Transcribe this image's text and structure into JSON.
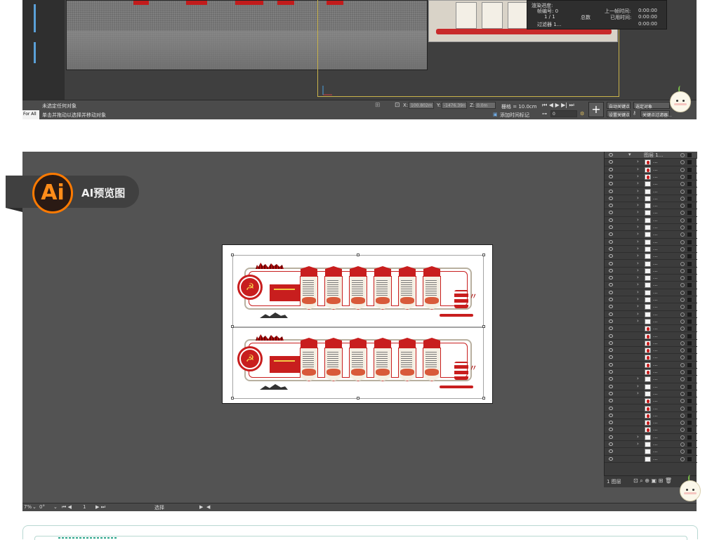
{
  "max_viewport": {
    "render_dialog": {
      "progress_label": "渲染进度:",
      "frame_label": "帧编号: 0",
      "frame_count": "1 / 1",
      "total_label": "总数",
      "prev_frame_label": "上一帧时间:",
      "prev_frame_time": "0:00:00",
      "elapsed_label": "已用时间:",
      "elapsed_time": "0:00:00",
      "last_line": "过滤器 1...",
      "remaining_time": "0:00:00"
    },
    "status": {
      "for_all_tab": "For All",
      "line1": "未选定任何对象",
      "line2": "单击并拖动以选择并移动对象",
      "x_value": "100.802m",
      "y_value": "-1476.39n",
      "z_value": "0.0m",
      "grid_label": "栅格 = 10.0cm",
      "add_time_tag": "添加时间标记",
      "auto_key": "自动关键点",
      "selected_object": "选定对象",
      "set_key": "设置关键点",
      "key_filters": "关键点过滤器...",
      "frame_field": "0"
    }
  },
  "ai_preview": {
    "badge_logo": "Ai",
    "badge_label": "AI预览图",
    "layers": {
      "top_layer_label": "图层 1...",
      "footer_label": "1 图层",
      "rows": [
        {
          "thumb": "red",
          "arrow": true
        },
        {
          "thumb": "red",
          "arrow": true
        },
        {
          "thumb": "red",
          "arrow": true
        },
        {
          "thumb": "plain",
          "arrow": true
        },
        {
          "thumb": "plain",
          "arrow": true
        },
        {
          "thumb": "plain",
          "arrow": true
        },
        {
          "thumb": "plain",
          "arrow": true
        },
        {
          "thumb": "plain",
          "arrow": true
        },
        {
          "thumb": "plain",
          "arrow": true
        },
        {
          "thumb": "plain",
          "arrow": true
        },
        {
          "thumb": "plain",
          "arrow": true
        },
        {
          "thumb": "plain",
          "arrow": true
        },
        {
          "thumb": "plain",
          "arrow": true
        },
        {
          "thumb": "plain",
          "arrow": true
        },
        {
          "thumb": "plain",
          "arrow": true
        },
        {
          "thumb": "plain",
          "arrow": true
        },
        {
          "thumb": "plain",
          "arrow": true
        },
        {
          "thumb": "plain",
          "arrow": true
        },
        {
          "thumb": "plain",
          "arrow": true
        },
        {
          "thumb": "plain",
          "arrow": true
        },
        {
          "thumb": "plain",
          "arrow": true
        },
        {
          "thumb": "plain",
          "arrow": true
        },
        {
          "thumb": "plain",
          "arrow": true
        },
        {
          "thumb": "red",
          "arrow": false
        },
        {
          "thumb": "red",
          "arrow": false
        },
        {
          "thumb": "red",
          "arrow": false
        },
        {
          "thumb": "red",
          "arrow": false
        },
        {
          "thumb": "red",
          "arrow": false
        },
        {
          "thumb": "red",
          "arrow": false
        },
        {
          "thumb": "red",
          "arrow": false
        },
        {
          "thumb": "plain",
          "arrow": true
        },
        {
          "thumb": "plain",
          "arrow": true
        },
        {
          "thumb": "plain",
          "arrow": true
        },
        {
          "thumb": "red",
          "arrow": false
        },
        {
          "thumb": "red",
          "arrow": false
        },
        {
          "thumb": "red",
          "arrow": false
        },
        {
          "thumb": "red",
          "arrow": false
        },
        {
          "thumb": "red",
          "arrow": false
        },
        {
          "thumb": "plain",
          "arrow": true
        },
        {
          "thumb": "plain",
          "arrow": true
        },
        {
          "thumb": "plain",
          "arrow": false
        },
        {
          "thumb": "plain",
          "arrow": false
        }
      ]
    },
    "status": {
      "zoom": "7%",
      "rotation": "0°",
      "artboard_nav": "1",
      "tool": "选择"
    }
  },
  "colors": {
    "accent_red": "#c81e1e",
    "ai_orange": "#ff7a00",
    "teal": "#2aa58a"
  }
}
